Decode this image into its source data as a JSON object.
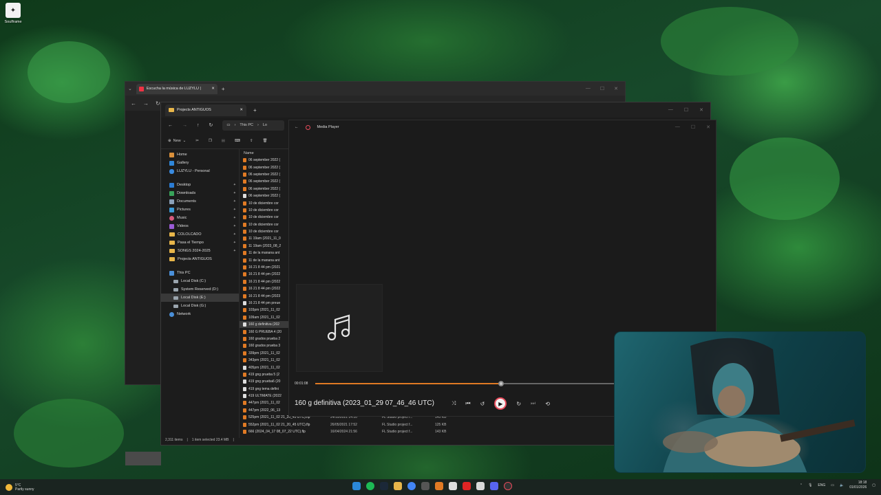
{
  "desktop": {
    "icon_label": "Soulframe"
  },
  "browser": {
    "tab_title": "Escucha la música de LUZYLU |"
  },
  "explorer": {
    "tab_title": "Projects ANTIGUOS",
    "address": {
      "root": "This PC",
      "partial": "Lo"
    },
    "toolbar": {
      "new_label": "New"
    },
    "column_header": "Name",
    "sidebar": {
      "top": [
        {
          "label": "Home",
          "icon": "home-icon"
        },
        {
          "label": "Gallery",
          "icon": "gallery-icon"
        },
        {
          "label": "LUZYLU - Personal",
          "icon": "onedrive-icon"
        }
      ],
      "quick": [
        {
          "label": "Desktop",
          "icon": "desktop-icon"
        },
        {
          "label": "Downloads",
          "icon": "downloads-icon"
        },
        {
          "label": "Documents",
          "icon": "documents-icon"
        },
        {
          "label": "Pictures",
          "icon": "pictures-icon"
        },
        {
          "label": "Music",
          "icon": "music-icon"
        },
        {
          "label": "Videos",
          "icon": "videos-icon"
        },
        {
          "label": "COLOLCADO",
          "icon": "folder-icon"
        },
        {
          "label": "Pasa el Tiempo",
          "icon": "folder-icon"
        },
        {
          "label": "SONGS 2024-2025",
          "icon": "folder-icon"
        },
        {
          "label": "Projects ANTIGUOS",
          "icon": "folder-icon"
        }
      ],
      "pc": [
        {
          "label": "This PC",
          "icon": "pc-icon"
        },
        {
          "label": "Local Disk (C:)",
          "icon": "drive-icon"
        },
        {
          "label": "System Reserved (D:)",
          "icon": "drive-icon"
        },
        {
          "label": "Local Disk (E:)",
          "icon": "drive-icon"
        },
        {
          "label": "Local Disk (G:)",
          "icon": "drive-icon"
        },
        {
          "label": "Network",
          "icon": "network-icon"
        }
      ]
    },
    "files": [
      {
        "name": "06 september 2022 (",
        "date": "",
        "type": "",
        "size": ""
      },
      {
        "name": "06 september 2022 (",
        "date": "",
        "type": "",
        "size": ""
      },
      {
        "name": "06 september 2022 (",
        "date": "",
        "type": "",
        "size": ""
      },
      {
        "name": "06 september 2022 (",
        "date": "",
        "type": "",
        "size": ""
      },
      {
        "name": "06 september 2022 (",
        "date": "",
        "type": "",
        "size": ""
      },
      {
        "name": "06 september 2022 (",
        "date": "",
        "type": "",
        "size": ""
      },
      {
        "name": "10 de diciembre cor",
        "date": "",
        "type": "",
        "size": ""
      },
      {
        "name": "10 de diciembre cor",
        "date": "",
        "type": "",
        "size": ""
      },
      {
        "name": "10 de diciembre cor",
        "date": "",
        "type": "",
        "size": ""
      },
      {
        "name": "10 de diciembre cor",
        "date": "",
        "type": "",
        "size": ""
      },
      {
        "name": "10 de diciembre cor",
        "date": "",
        "type": "",
        "size": ""
      },
      {
        "name": "11 19am (2021_11_0",
        "date": "",
        "type": "",
        "size": ""
      },
      {
        "name": "11 19am (2023_08_2",
        "date": "",
        "type": "",
        "size": ""
      },
      {
        "name": "11 de la manana ant",
        "date": "",
        "type": "",
        "size": ""
      },
      {
        "name": "11 de la manana ant",
        "date": "",
        "type": "",
        "size": ""
      },
      {
        "name": "16 21 8 44 pm (2021",
        "date": "",
        "type": "",
        "size": ""
      },
      {
        "name": "16 21 8 44 pm (2022",
        "date": "",
        "type": "",
        "size": ""
      },
      {
        "name": "16 21 8 44 pm (2022",
        "date": "",
        "type": "",
        "size": ""
      },
      {
        "name": "16 21 8 44 pm (2022",
        "date": "",
        "type": "",
        "size": ""
      },
      {
        "name": "16 21 8 44 pm (2023",
        "date": "",
        "type": "",
        "size": ""
      },
      {
        "name": "16 21 8 44 pm preue",
        "date": "",
        "type": "",
        "size": ""
      },
      {
        "name": "103pm (2021_11_02",
        "date": "",
        "type": "",
        "size": ""
      },
      {
        "name": "109am (2021_11_02",
        "date": "",
        "type": "",
        "size": ""
      },
      {
        "name": "160 g definitiva (202",
        "date": "",
        "type": "",
        "size": "",
        "selected": true
      },
      {
        "name": "160 G PRUEBA 4 (20",
        "date": "",
        "type": "",
        "size": ""
      },
      {
        "name": "160 grados prueba 2",
        "date": "",
        "type": "",
        "size": ""
      },
      {
        "name": "160 grados prueba 3",
        "date": "",
        "type": "",
        "size": ""
      },
      {
        "name": "339pm (2021_11_02",
        "date": "",
        "type": "",
        "size": ""
      },
      {
        "name": "343pm (2021_11_02",
        "date": "",
        "type": "",
        "size": ""
      },
      {
        "name": "405pm (2021_11_02",
        "date": "",
        "type": "",
        "size": ""
      },
      {
        "name": "419 gng prueba 5 (2",
        "date": "",
        "type": "",
        "size": ""
      },
      {
        "name": "419 gng prueba6 (20",
        "date": "",
        "type": "",
        "size": ""
      },
      {
        "name": "419 gng tema defini",
        "date": "",
        "type": "",
        "size": ""
      },
      {
        "name": "419 ULTIMATE (2022",
        "date": "",
        "type": "",
        "size": ""
      },
      {
        "name": "447pm (2021_11_02",
        "date": "",
        "type": "",
        "size": ""
      },
      {
        "name": "447pm (2022_06_13",
        "date": "",
        "type": "",
        "size": ""
      },
      {
        "name": "525pm (2021_11_02 21_20_45 UTC).flp",
        "date": "24/10/2021 14:10",
        "type": "FL Studio project f...",
        "size": "145 KB"
      },
      {
        "name": "552pm (2021_11_02 21_20_45 UTC).flp",
        "date": "26/05/2021 17:52",
        "type": "FL Studio project f...",
        "size": "125 KB"
      },
      {
        "name": "666 (2024_04_17 08_07_22 UTC).flp",
        "date": "16/04/2024 21:56",
        "type": "FL Studio project f...",
        "size": "143 KB"
      }
    ],
    "status": {
      "count": "2,311 items",
      "selection": "1 item selected  23.4 MB"
    }
  },
  "player": {
    "app_title": "Media Player",
    "current_time": "00:01:08",
    "progress": 0.54,
    "track_title": "160 g definitiva (2023_01_29 07_46_46 UTC)"
  },
  "taskbar": {
    "weather_temp": "5°C",
    "weather_desc": "Partly sunny",
    "language": "ENG",
    "time": "18:18",
    "date": "01/01/2026"
  },
  "colors": {
    "accent": "#e07a24",
    "play_ring": "#e84b5b"
  }
}
